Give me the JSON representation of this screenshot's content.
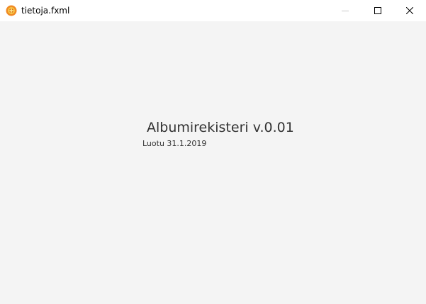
{
  "window": {
    "title": "tietoja.fxml"
  },
  "content": {
    "heading": "Albumirekisteri v.0.01",
    "created": "Luotu 31.1.2019"
  },
  "colors": {
    "icon_outer": "#f08a24",
    "icon_inner": "#f5c542",
    "background": "#f4f4f4",
    "titlebar": "#ffffff",
    "text": "#333333"
  }
}
